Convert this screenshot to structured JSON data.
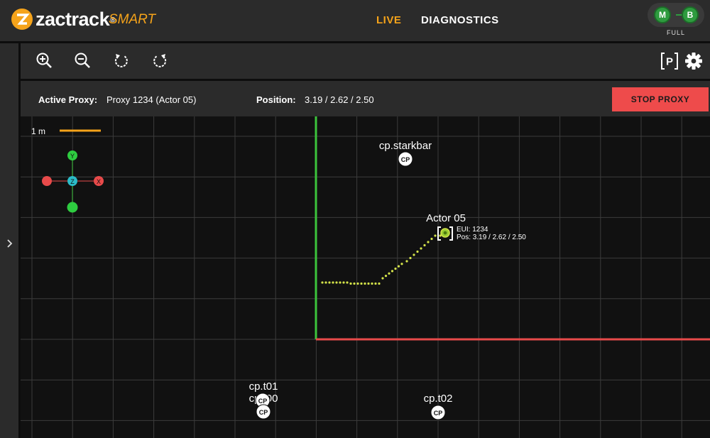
{
  "header": {
    "brand": "zactrack",
    "brand_reg": "®",
    "brand_suffix": "SMART",
    "nav": [
      {
        "label": "LIVE",
        "active": true
      },
      {
        "label": "DIAGNOSTICS",
        "active": false
      }
    ],
    "status": {
      "left": "M",
      "right": "B",
      "label": "FULL",
      "color": "#2e9b3f"
    }
  },
  "toolbar": {
    "left_icons": [
      "zoom-in-icon",
      "zoom-out-icon",
      "rotate-left-icon",
      "rotate-right-icon"
    ],
    "right_icons": [
      "proxy-p-icon",
      "gear-icon"
    ],
    "proxy_icon_text": "P"
  },
  "proxy_bar": {
    "active_proxy_label": "Active Proxy:",
    "active_proxy_value": "Proxy 1234 (Actor 05)",
    "position_label": "Position:",
    "position_value": "3.19 / 2.62 / 2.50",
    "stop_button": "STOP PROXY"
  },
  "scene": {
    "scale_label": "1 m",
    "axis_gizmo": {
      "y": "Y",
      "z": "Z",
      "x": "X"
    },
    "checkpoints": [
      {
        "name": "cp.starkbar",
        "badge": "CP"
      },
      {
        "name": "cp.t01",
        "badge": "CP"
      },
      {
        "name": "cp.t00",
        "badge": "CP"
      },
      {
        "name": "cp.t02",
        "badge": "CP"
      }
    ],
    "actor": {
      "name": "Actor 05",
      "eui": "EUI: 1234",
      "pos": "Pos: 3.19 / 2.62 / 2.50"
    },
    "colors": {
      "accent": "#f5a31a",
      "y_axis": "#3cc43c",
      "x_axis": "#e84a4a",
      "trail": "#d4e34a",
      "grid": "#3c3c3c"
    }
  }
}
